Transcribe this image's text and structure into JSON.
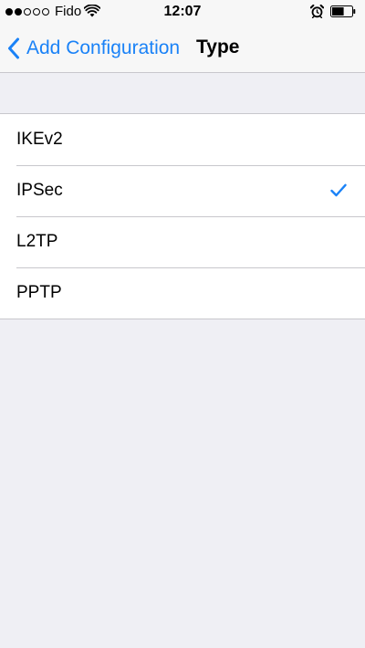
{
  "status_bar": {
    "carrier": "Fido",
    "time": "12:07",
    "signal_bars_filled": 2,
    "signal_bars_total": 5,
    "battery_level": 0.6
  },
  "nav": {
    "back_label": "Add Configuration",
    "title": "Type"
  },
  "types": [
    {
      "label": "IKEv2",
      "selected": false
    },
    {
      "label": "IPSec",
      "selected": true
    },
    {
      "label": "L2TP",
      "selected": false
    },
    {
      "label": "PPTP",
      "selected": false
    }
  ],
  "colors": {
    "accent": "#1a82f7",
    "background": "#efeff4",
    "bar": "#f7f7f7",
    "separator": "#c8c7cc"
  },
  "icons": {
    "back": "chevron-left-icon",
    "check": "checkmark-icon",
    "wifi": "wifi-icon",
    "alarm": "alarm-clock-icon",
    "battery": "battery-icon"
  }
}
